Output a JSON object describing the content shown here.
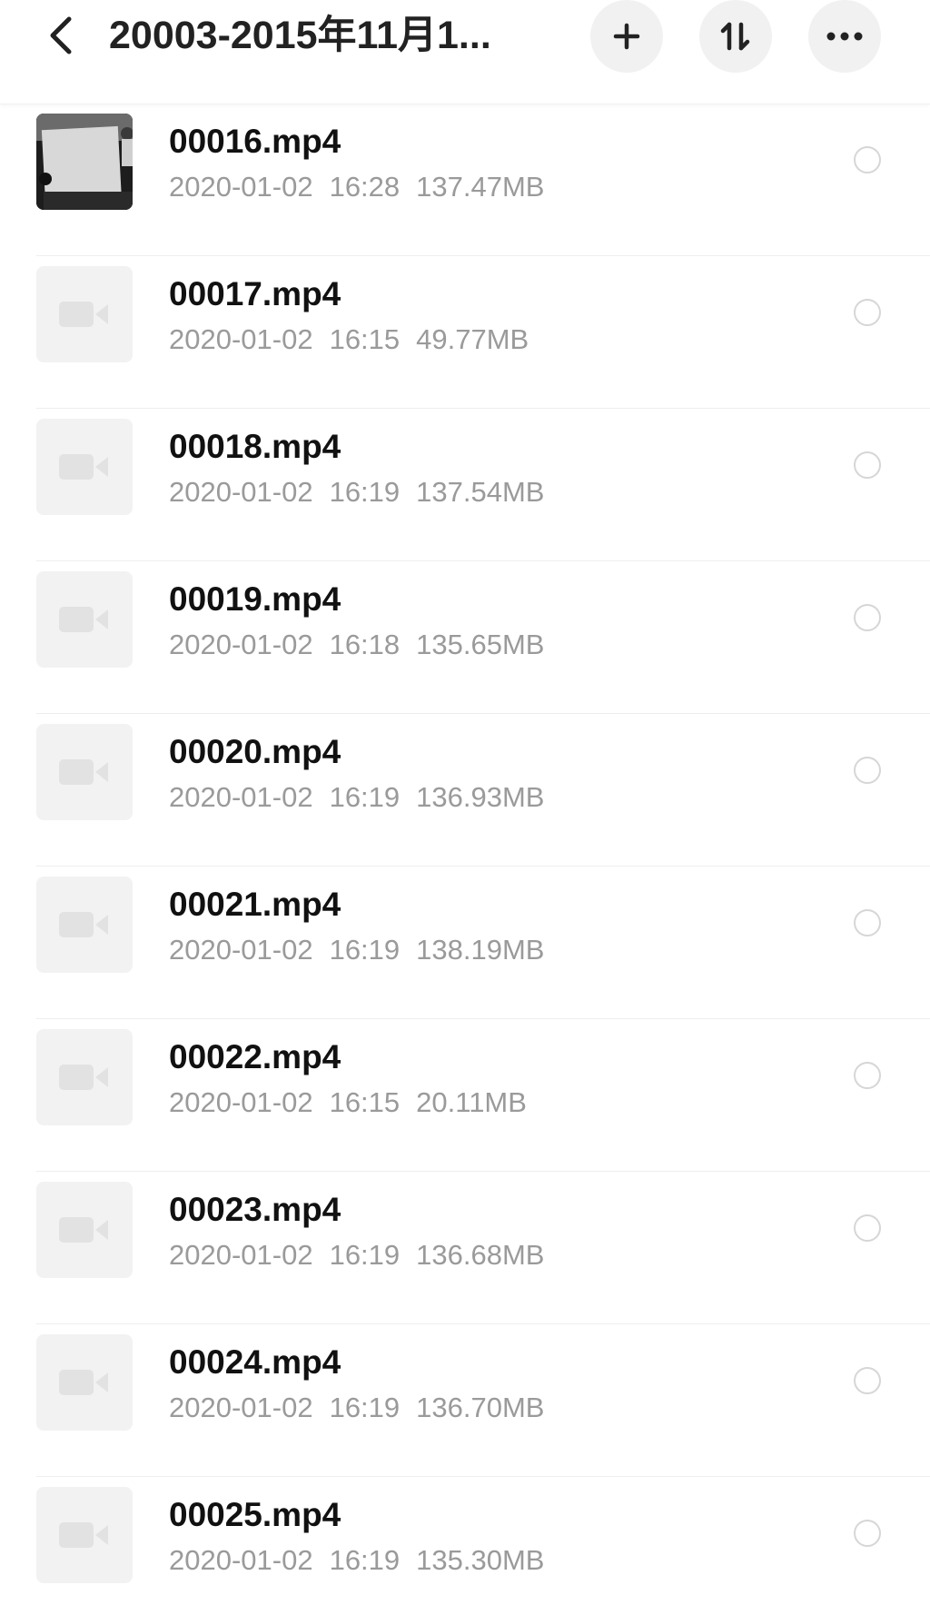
{
  "header": {
    "back_icon": "chevron-left-icon",
    "title": "20003-2015年11月1...",
    "add_icon": "plus-icon",
    "sort_icon": "sort-icon",
    "more_icon": "more-horizontal-icon"
  },
  "colors": {
    "title_text": "#222222",
    "file_name_text": "#111111",
    "meta_text": "#9a9a9a",
    "button_bg": "#f1f1f1",
    "placeholder_bg": "#f2f2f2",
    "divider": "#eeeeee"
  },
  "files": [
    {
      "name": "00016.mp4",
      "date": "2020-01-02",
      "time": "16:28",
      "size": "137.47MB",
      "thumb": "photo"
    },
    {
      "name": "00017.mp4",
      "date": "2020-01-02",
      "time": "16:15",
      "size": "49.77MB",
      "thumb": "video-placeholder-icon"
    },
    {
      "name": "00018.mp4",
      "date": "2020-01-02",
      "time": "16:19",
      "size": "137.54MB",
      "thumb": "video-placeholder-icon"
    },
    {
      "name": "00019.mp4",
      "date": "2020-01-02",
      "time": "16:18",
      "size": "135.65MB",
      "thumb": "video-placeholder-icon"
    },
    {
      "name": "00020.mp4",
      "date": "2020-01-02",
      "time": "16:19",
      "size": "136.93MB",
      "thumb": "video-placeholder-icon"
    },
    {
      "name": "00021.mp4",
      "date": "2020-01-02",
      "time": "16:19",
      "size": "138.19MB",
      "thumb": "video-placeholder-icon"
    },
    {
      "name": "00022.mp4",
      "date": "2020-01-02",
      "time": "16:15",
      "size": "20.11MB",
      "thumb": "video-placeholder-icon"
    },
    {
      "name": "00023.mp4",
      "date": "2020-01-02",
      "time": "16:19",
      "size": "136.68MB",
      "thumb": "video-placeholder-icon"
    },
    {
      "name": "00024.mp4",
      "date": "2020-01-02",
      "time": "16:19",
      "size": "136.70MB",
      "thumb": "video-placeholder-icon"
    },
    {
      "name": "00025.mp4",
      "date": "2020-01-02",
      "time": "16:19",
      "size": "135.30MB",
      "thumb": "video-placeholder-icon"
    }
  ]
}
